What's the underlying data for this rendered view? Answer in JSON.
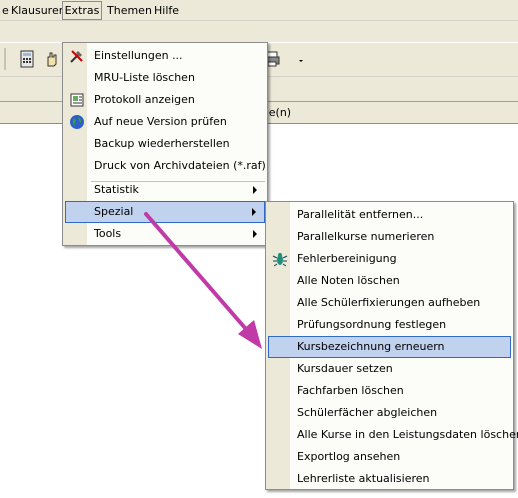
{
  "menubar": {
    "klausuren": "Klausuren",
    "extras": "Extras",
    "themen": "Themen",
    "hilfe": "Hilfe"
  },
  "table_header_fragment": "hiene(n)",
  "extras_menu": {
    "einstellungen": "Einstellungen ...",
    "mru": "MRU-Liste löschen",
    "protokoll": "Protokoll anzeigen",
    "neue_version": "Auf neue Version prüfen",
    "backup": "Backup wiederherstellen",
    "druck": "Druck von Archivdateien (*.raf)",
    "statistik": "Statistik",
    "spezial": "Spezial",
    "tools": "Tools"
  },
  "spezial_menu": {
    "parallelitaet": "Parallelität entfernen...",
    "parallelkurse": "Parallelkurse numerieren",
    "fehlerbereinigung": "Fehlerbereinigung",
    "noten": "Alle Noten löschen",
    "fixierungen": "Alle Schülerfixierungen aufheben",
    "pruefungsordnung": "Prüfungsordnung festlegen",
    "kursbezeichnung": "Kursbezeichnung erneuern",
    "kursdauer": "Kursdauer setzen",
    "fachfarben": "Fachfarben löschen",
    "schuelerfaecher": "Schülerfächer abgleichen",
    "kurse_loeschen": "Alle Kurse in den Leistungsdaten löschen",
    "exportlog": "Exportlog ansehen",
    "lehrerliste": "Lehrerliste aktualisieren"
  },
  "colors": {
    "highlight_bg": "#c1d2ee",
    "highlight_border": "#316ac5",
    "annotation_arrow": "#c03aa8"
  }
}
